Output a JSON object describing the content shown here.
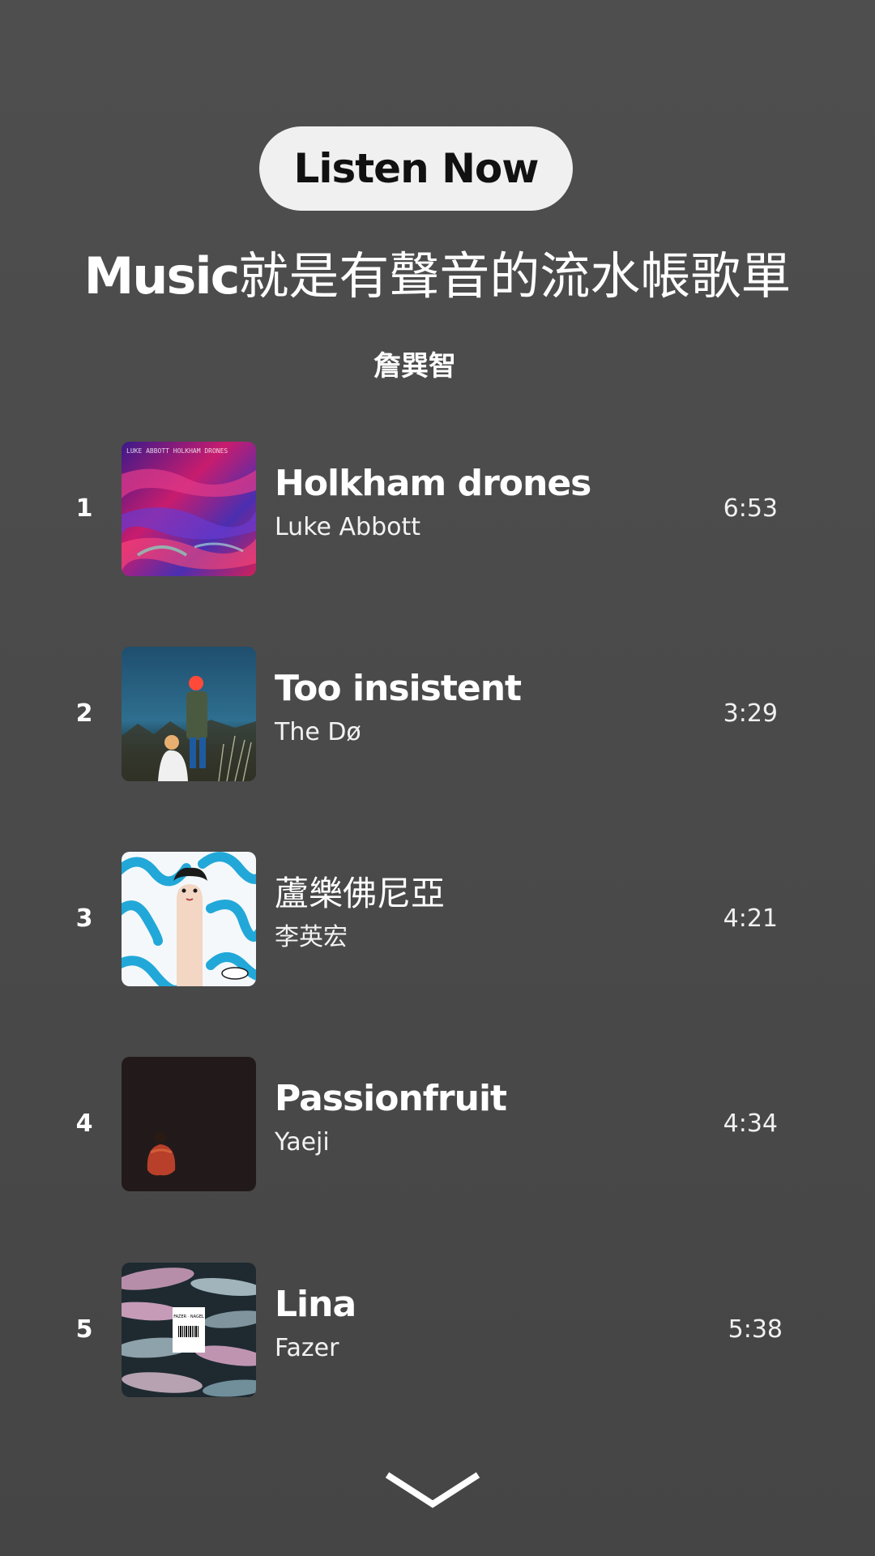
{
  "header": {
    "listen_now_label": "Listen Now",
    "title_latin": "Music",
    "title_cjk": "就是有聲音的流水帳歌單",
    "author": "詹巽智"
  },
  "tracks": [
    {
      "number": "1",
      "title": "Holkham drones",
      "artist": "Luke Abbott",
      "duration": "6:53",
      "cover_text": "LUKE ABBOTT HOLKHAM DRONES"
    },
    {
      "number": "2",
      "title": "Too insistent",
      "artist": "The Dø",
      "duration": "3:29"
    },
    {
      "number": "3",
      "title": "蘆樂佛尼亞",
      "artist": "李英宏",
      "duration": "4:21"
    },
    {
      "number": "4",
      "title": "Passionfruit",
      "artist": "Yaeji",
      "duration": "4:34"
    },
    {
      "number": "5",
      "title": "Lina",
      "artist": "Fazer",
      "duration": "5:38",
      "cover_text": "FAZER · NAGEL"
    }
  ],
  "icons": {
    "scroll_down": "chevron-down-icon"
  },
  "colors": {
    "background": "#4a4a4a",
    "button_bg": "#f0f0f0",
    "button_text": "#111111",
    "text": "#ffffff"
  }
}
